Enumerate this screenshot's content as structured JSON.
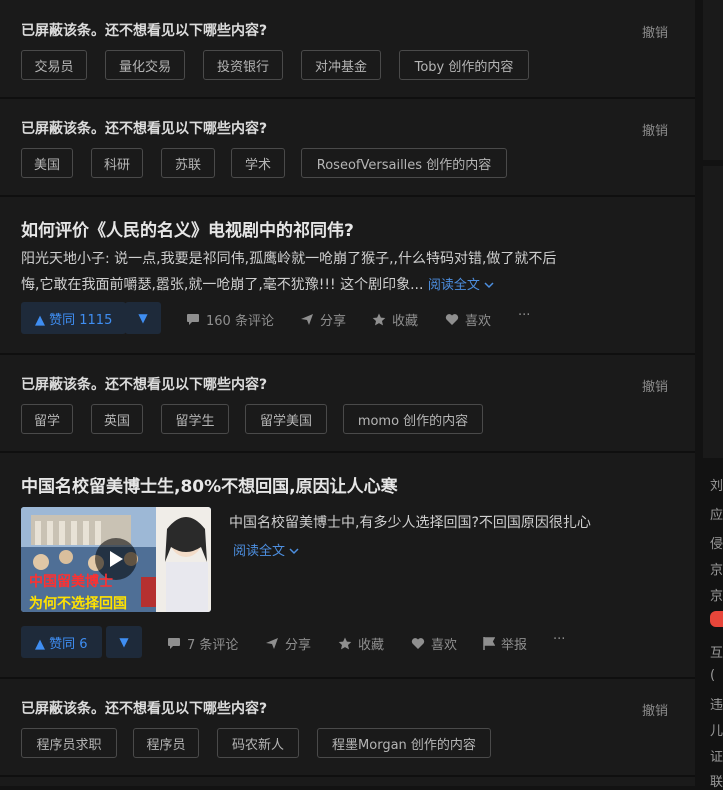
{
  "blocked": [
    {
      "title": "已屏蔽该条。还不想看见以下哪些内容?",
      "undo": "撤销",
      "tags": [
        "交易员",
        "量化交易",
        "投资银行",
        "对冲基金",
        "Toby 创作的内容"
      ]
    },
    {
      "title": "已屏蔽该条。还不想看见以下哪些内容?",
      "undo": "撤销",
      "tags": [
        "美国",
        "科研",
        "苏联",
        "学术",
        "RoseofVersailles 创作的内容"
      ]
    },
    {
      "title": "已屏蔽该条。还不想看见以下哪些内容?",
      "undo": "撤销",
      "tags": [
        "留学",
        "英国",
        "留学生",
        "留学美国",
        "momo 创作的内容"
      ]
    },
    {
      "title": "已屏蔽该条。还不想看见以下哪些内容?",
      "undo": "撤销",
      "tags": [
        "程序员求职",
        "程序员",
        "码农新人",
        "程墨Morgan 创作的内容"
      ]
    }
  ],
  "answer": {
    "title": "如何评价《人民的名义》电视剧中的祁同伟?",
    "excerpt_line1": "阳光天地小子: 说一点,我要是祁同伟,孤鹰岭就一呛崩了猴子,,什么特码对错,做了就不后",
    "excerpt_line2": "悔,它敢在我面前嚼瑟,嚣张,就一呛崩了,毫不犹豫!!! 这个剧印象...",
    "read_more": "阅读全文",
    "vote": "▲ 赞同 1115",
    "actions": {
      "comments": "160 条评论",
      "share": "分享",
      "favorite": "收藏",
      "like": "喜欢",
      "more": "···"
    }
  },
  "video_post": {
    "title": "中国名校留美博士生,80%不想回国,原因让人心寒",
    "summary": "中国名校留美博士中,有多少人选择回国?不回国原因很扎心",
    "read_more": "阅读全文",
    "thumb_line1": "中国留美博士",
    "thumb_line2": "为何不选择回国",
    "vote": "▲ 赞同 6",
    "actions": {
      "comments": "7 条评论",
      "share": "分享",
      "favorite": "收藏",
      "like": "喜欢",
      "report": "举报",
      "more": "···"
    }
  },
  "sidebar_chars": [
    "刘",
    "应",
    "侵",
    "京",
    "京",
    "互",
    "(",
    "违",
    "儿",
    "证",
    "联"
  ],
  "colors": {
    "background": "#1a1a1a",
    "accent": "#3f8ef2",
    "vote_bg": "#1e2a3a"
  }
}
